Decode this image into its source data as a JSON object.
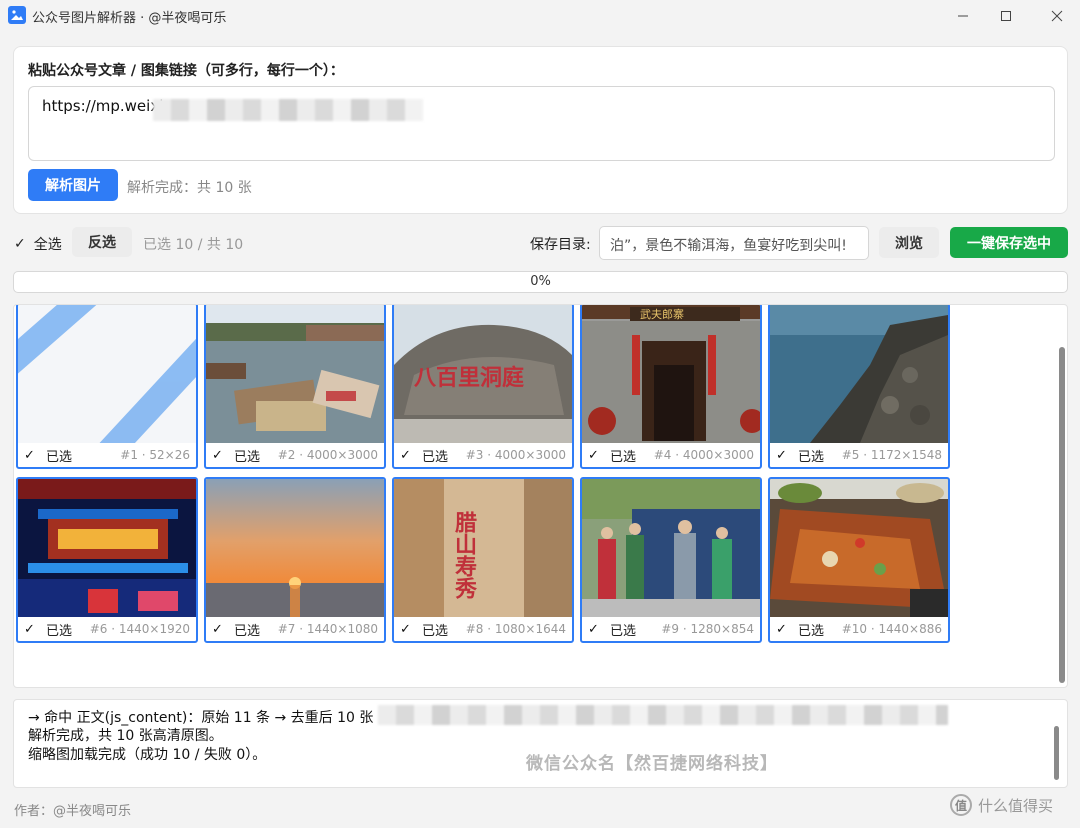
{
  "window": {
    "title": "公众号图片解析器 · @半夜喝可乐"
  },
  "input_card": {
    "label": "粘贴公众号文章 / 图集链接（可多行，每行一个）：",
    "url_value": "https://mp.weixi",
    "parse_button": "解析图片",
    "status": "解析完成：共 10 张"
  },
  "toolbar": {
    "select_all": "全选",
    "invert": "反选",
    "selected_count": "已选 10 / 共 10",
    "save_dir_label": "保存目录:",
    "save_dir_value": "泊”，景色不输洱海，鱼宴好吃到尖叫!",
    "browse": "浏览",
    "save_selected": "一键保存选中"
  },
  "progress": {
    "value": 0,
    "label": "0%"
  },
  "thumbnails": [
    {
      "index": "#1",
      "size": "52×26",
      "selected_label": "已选",
      "meta": "#1 · 52×26"
    },
    {
      "index": "#2",
      "size": "4000×3000",
      "selected_label": "已选",
      "meta": "#2 · 4000×3000"
    },
    {
      "index": "#3",
      "size": "4000×3000",
      "selected_label": "已选",
      "meta": "#3 · 4000×3000"
    },
    {
      "index": "#4",
      "size": "4000×3000",
      "selected_label": "已选",
      "meta": "#4 · 4000×3000"
    },
    {
      "index": "#5",
      "size": "1172×1548",
      "selected_label": "已选",
      "meta": "#5 · 1172×1548"
    },
    {
      "index": "#6",
      "size": "1440×1920",
      "selected_label": "已选",
      "meta": "#6 · 1440×1920"
    },
    {
      "index": "#7",
      "size": "1440×1080",
      "selected_label": "已选",
      "meta": "#7 · 1440×1080"
    },
    {
      "index": "#8",
      "size": "1080×1644",
      "selected_label": "已选",
      "meta": "#8 · 1080×1644"
    },
    {
      "index": "#9",
      "size": "1280×854",
      "selected_label": "已选",
      "meta": "#9 · 1280×854"
    },
    {
      "index": "#10",
      "size": "1440×886",
      "selected_label": "已选",
      "meta": "#10 · 1440×886"
    }
  ],
  "thumb_text": {
    "t3": "八百里洞庭",
    "t4": "武夫郎寨",
    "t8": "腊山寿秀"
  },
  "log": {
    "line1": "→ 命中 正文(js_content)：原始 11 条 → 去重后 10 张",
    "line2": "解析完成，共 10 张高清原图。",
    "line3": "缩略图加载完成（成功 10 / 失败 0）。",
    "watermark": "微信公众名【然百捷网络科技】"
  },
  "footer": {
    "author": "作者：@半夜喝可乐",
    "corner_text": "什么值得买",
    "corner_logo": "值"
  },
  "colors": {
    "primary": "#2f7cf6",
    "success": "#18a948"
  }
}
